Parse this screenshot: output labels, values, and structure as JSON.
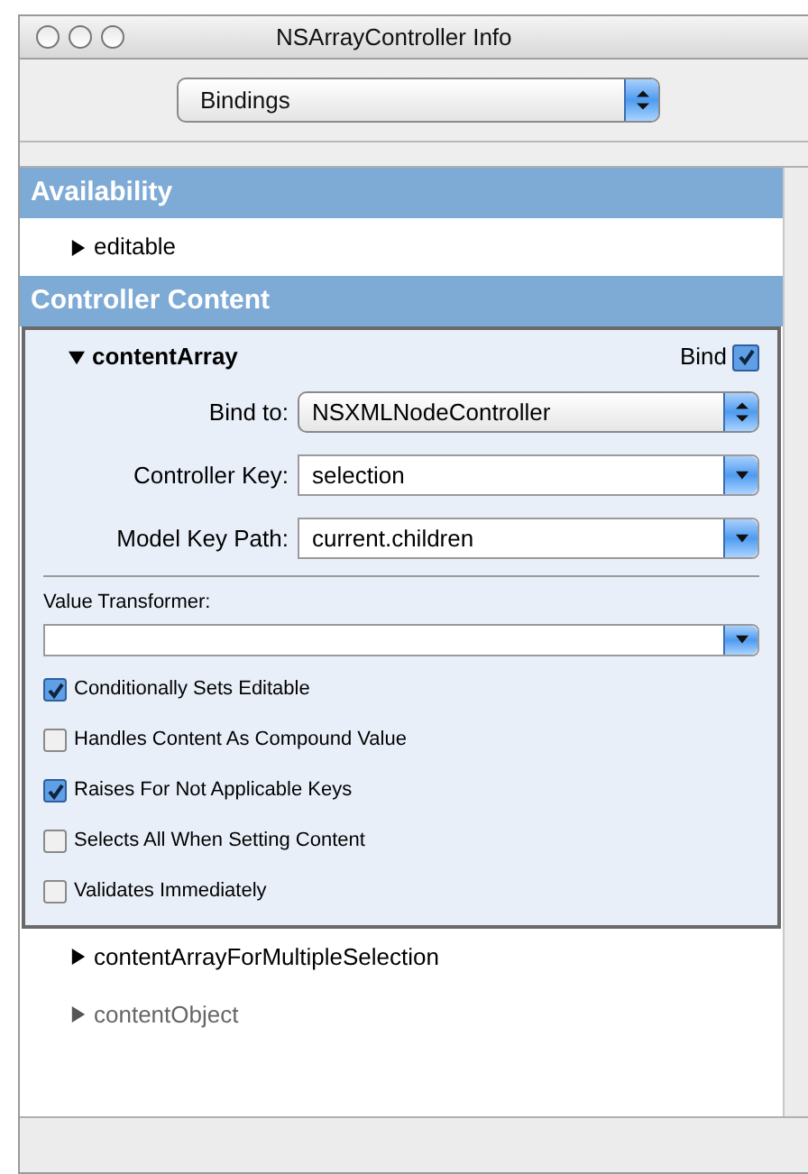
{
  "window": {
    "title": "NSArrayController Info"
  },
  "toolbar": {
    "popup": "Bindings"
  },
  "sections": [
    {
      "title": "Availability",
      "bindings": [
        {
          "name": "editable",
          "expanded": false,
          "disabled": false
        }
      ]
    },
    {
      "title": "Controller Content",
      "bindings": [
        {
          "name": "contentArray",
          "expanded": true,
          "disabled": false,
          "bind_label": "Bind",
          "bind_checked": true,
          "fields": [
            {
              "label": "Bind to:",
              "value": "NSXMLNodeController",
              "kind": "popup"
            },
            {
              "label": "Controller Key:",
              "value": "selection",
              "kind": "combo"
            },
            {
              "label": "Model Key Path:",
              "value": "current.children",
              "kind": "combo"
            }
          ],
          "value_transformer": {
            "label": "Value Transformer:"
          },
          "options": [
            {
              "label": "Conditionally Sets Editable",
              "checked": true
            },
            {
              "label": "Handles Content As Compound Value",
              "checked": false
            },
            {
              "label": "Raises For Not Applicable Keys",
              "checked": true
            },
            {
              "label": "Selects All When Setting Content",
              "checked": false
            },
            {
              "label": "Validates Immediately",
              "checked": false
            }
          ]
        },
        {
          "name": "contentArrayForMultipleSelection",
          "expanded": false,
          "disabled": false
        },
        {
          "name": "contentObject",
          "expanded": false,
          "disabled": true
        }
      ]
    }
  ]
}
